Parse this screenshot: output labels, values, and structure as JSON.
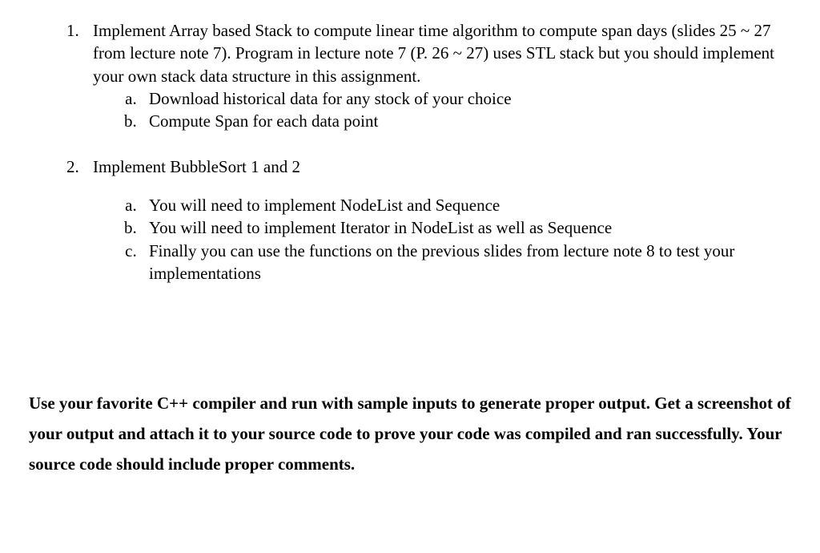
{
  "list": {
    "item1": {
      "text": "Implement Array based Stack to compute linear time algorithm to compute span days (slides 25 ~ 27 from lecture note 7). Program in lecture note 7 (P. 26 ~ 27) uses STL stack but you should implement your own stack data structure in this assignment.",
      "sub": {
        "a": "Download historical data for any stock of your choice",
        "b": "Compute Span for each data point"
      }
    },
    "item2": {
      "text": "Implement BubbleSort 1 and 2",
      "sub": {
        "a": "You will need to implement NodeList and Sequence",
        "b": "You will need to implement Iterator in NodeList as well as Sequence",
        "c": "Finally you can use the functions on the previous slides from lecture note 8 to test your implementations"
      }
    }
  },
  "footer": "Use your favorite C++ compiler and run with sample inputs to generate proper output. Get a screenshot of your output and attach it to your source code to prove your code was compiled and ran successfully. Your source code should include proper comments."
}
